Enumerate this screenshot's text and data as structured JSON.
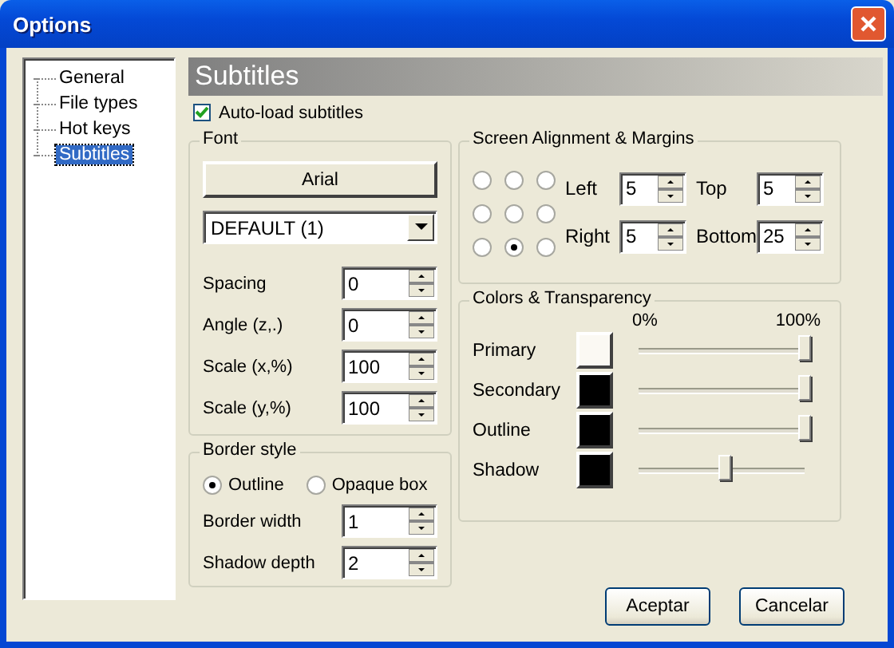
{
  "window": {
    "title": "Options"
  },
  "tree": {
    "items": [
      {
        "label": "General",
        "selected": false
      },
      {
        "label": "File types",
        "selected": false
      },
      {
        "label": "Hot keys",
        "selected": false
      },
      {
        "label": "Subtitles",
        "selected": true
      }
    ]
  },
  "page": {
    "title": "Subtitles",
    "auto_load": {
      "label": "Auto-load subtitles",
      "checked": true
    }
  },
  "font": {
    "legend": "Font",
    "font_button": "Arial",
    "style_dropdown": "DEFAULT (1)",
    "fields": [
      {
        "label": "Spacing",
        "value": "0"
      },
      {
        "label": "Angle (z,.)",
        "value": "0"
      },
      {
        "label": "Scale (x,%)",
        "value": "100"
      },
      {
        "label": "Scale (y,%)",
        "value": "100"
      }
    ]
  },
  "border": {
    "legend": "Border style",
    "options": [
      {
        "label": "Outline",
        "selected": true
      },
      {
        "label": "Opaque box",
        "selected": false
      }
    ],
    "fields": [
      {
        "label": "Border width",
        "value": "1"
      },
      {
        "label": "Shadow depth",
        "value": "2"
      }
    ]
  },
  "alignment": {
    "legend": "Screen Alignment & Margins",
    "positions": [
      {
        "selected": false
      },
      {
        "selected": false
      },
      {
        "selected": false
      },
      {
        "selected": false
      },
      {
        "selected": false
      },
      {
        "selected": false
      },
      {
        "selected": false
      },
      {
        "selected": true
      },
      {
        "selected": false
      }
    ],
    "margins": [
      {
        "label": "Left",
        "value": "5"
      },
      {
        "label": "Top",
        "value": "5"
      },
      {
        "label": "Right",
        "value": "5"
      },
      {
        "label": "Bottom",
        "value": "25"
      }
    ]
  },
  "colors": {
    "legend": "Colors & Transparency",
    "min_label": "0%",
    "max_label": "100%",
    "rows": [
      {
        "label": "Primary",
        "color": "#fbf9f3",
        "level": 1.0
      },
      {
        "label": "Secondary",
        "color": "#000000",
        "level": 1.0
      },
      {
        "label": "Outline",
        "color": "#000000",
        "level": 1.0
      },
      {
        "label": "Shadow",
        "color": "#000000",
        "level": 0.52
      }
    ]
  },
  "buttons": [
    "Aceptar",
    "Cancelar"
  ]
}
